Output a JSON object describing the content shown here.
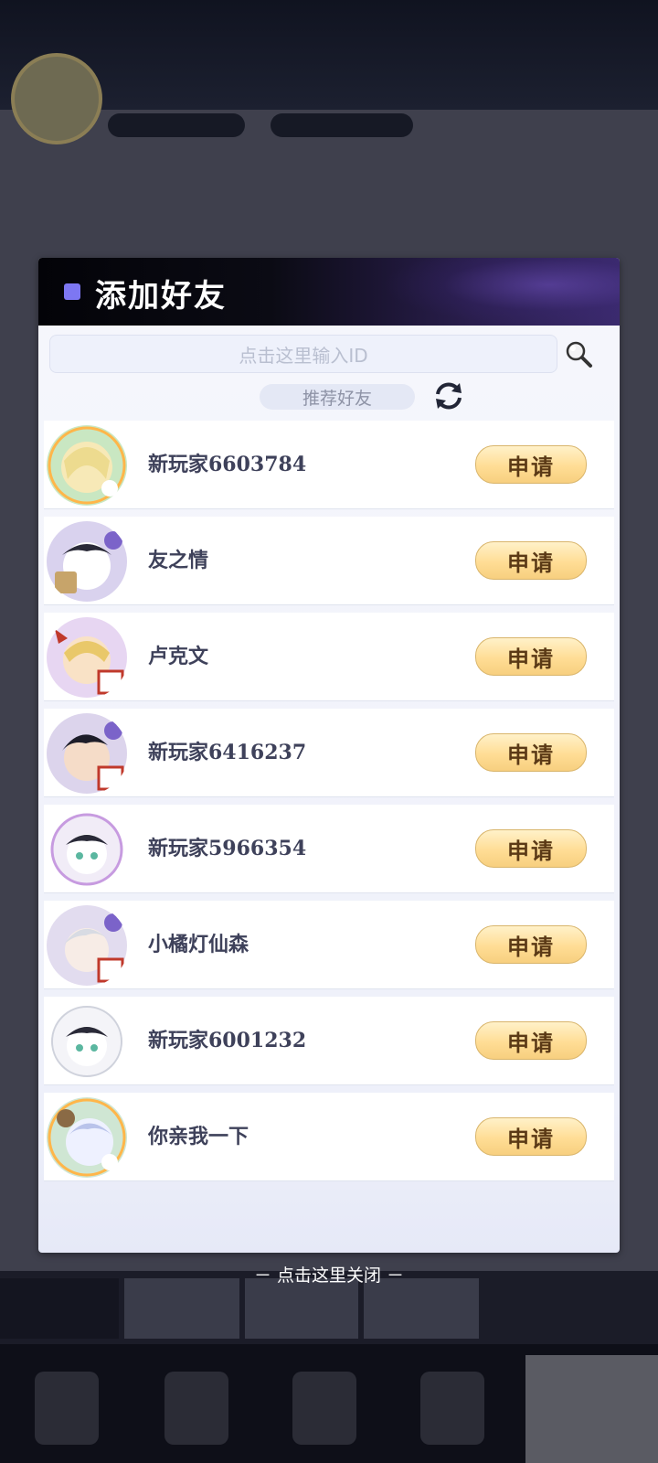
{
  "dialog": {
    "title": "添加好友",
    "search_placeholder": "点击这里输入ID",
    "recommend_label": "推荐好友",
    "apply_label": "申请",
    "close_hint": "－ 点击这里关闭 －"
  },
  "players": [
    {
      "name": "新玩家6603784"
    },
    {
      "name": "友之情"
    },
    {
      "name": "卢克文"
    },
    {
      "name": "新玩家6416237"
    },
    {
      "name": "新玩家5966354"
    },
    {
      "name": "小橘灯仙森"
    },
    {
      "name": "新玩家6001232"
    },
    {
      "name": "你亲我一下"
    }
  ],
  "colors": {
    "accent_marker": "#7d77f2",
    "apply_button": "#ffdd95",
    "name_text": "#3e415a"
  }
}
